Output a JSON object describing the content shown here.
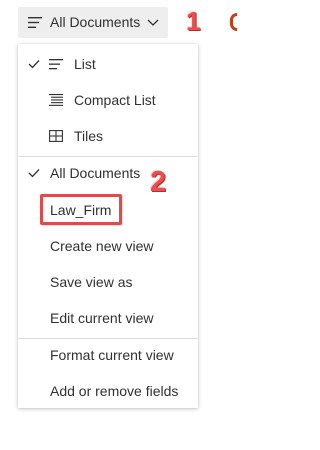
{
  "view_switcher": {
    "label": "All Documents",
    "icon": "list-icon",
    "dropdown_icon": "chevron-down-icon"
  },
  "annotations": {
    "step1": "1",
    "step2": "2",
    "color": "#ee4d4d"
  },
  "menu": {
    "layout_options": [
      {
        "label": "List",
        "icon": "list-icon",
        "checked": true
      },
      {
        "label": "Compact List",
        "icon": "compact-list-icon",
        "checked": false
      },
      {
        "label": "Tiles",
        "icon": "tiles-icon",
        "checked": false
      }
    ],
    "views": [
      {
        "label": "All Documents",
        "checked": true
      },
      {
        "label": "Law_Firm",
        "checked": false
      },
      {
        "label": "Create new view"
      },
      {
        "label": "Save view as"
      },
      {
        "label": "Edit current view"
      }
    ],
    "field_options": [
      {
        "label": "Format current view"
      },
      {
        "label": "Add or remove fields"
      }
    ]
  },
  "colors": {
    "accent": "#0078d4",
    "highlight_border": "#e8474a",
    "text": "#323130"
  }
}
